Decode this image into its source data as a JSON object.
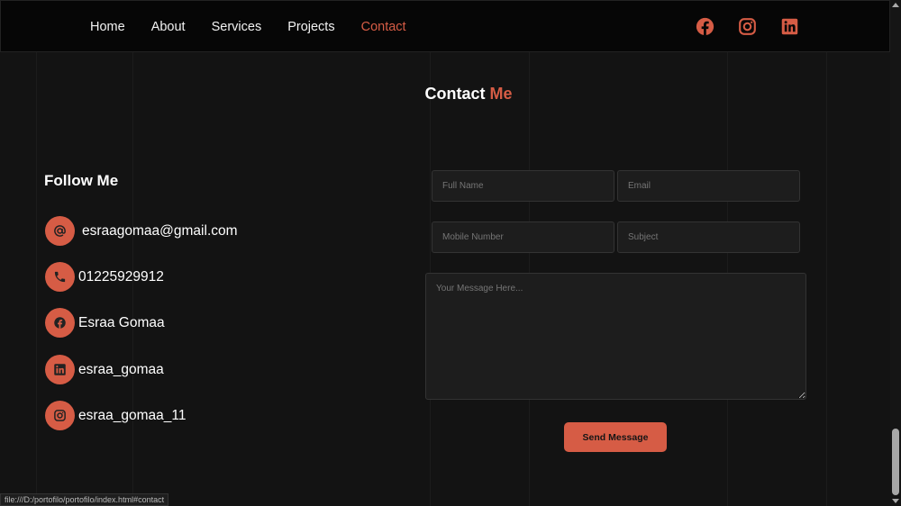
{
  "nav": {
    "items": [
      "Home",
      "About",
      "Services",
      "Projects",
      "Contact"
    ],
    "active": "Contact"
  },
  "heading": {
    "part1": "Contact",
    "part2": "Me"
  },
  "follow": {
    "title": "Follow Me",
    "items": [
      {
        "icon": "at-icon",
        "text": "esraagomaa@gmail.com"
      },
      {
        "icon": "phone-icon",
        "text": "01225929912"
      },
      {
        "icon": "facebook-icon",
        "text": "Esraa Gomaa"
      },
      {
        "icon": "linkedin-icon",
        "text": "esraa_gomaa"
      },
      {
        "icon": "instagram-icon",
        "text": "esraa_gomaa_11"
      }
    ]
  },
  "form": {
    "full_name": "Full Name",
    "email": "Email",
    "mobile": "Mobile Number",
    "subject": "Subject",
    "message": "Your Message Here...",
    "send": "Send Message"
  },
  "status_bar": "file:///D:/portofilo/portofilo/index.html#contact",
  "colors": {
    "accent": "#d65c45",
    "bg": "#131313"
  }
}
